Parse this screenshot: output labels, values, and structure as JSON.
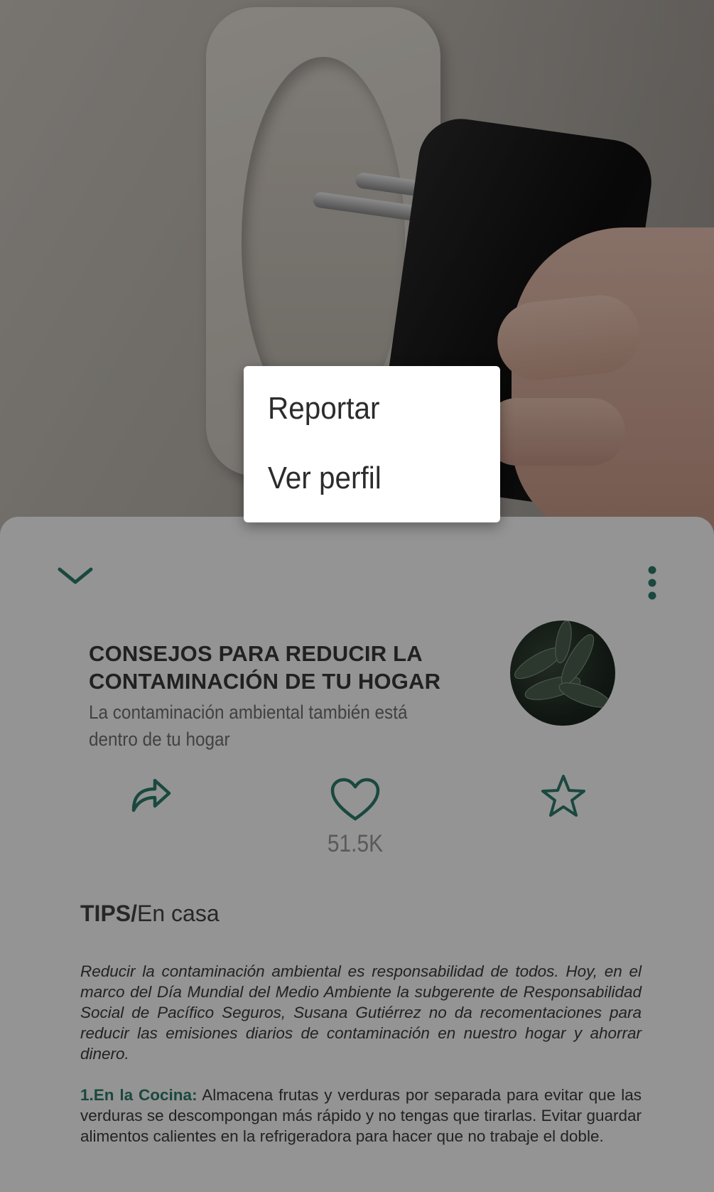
{
  "menu": {
    "items": [
      {
        "label": "Reportar"
      },
      {
        "label": "Ver perfil"
      }
    ]
  },
  "article": {
    "title": "CONSEJOS PARA REDUCIR LA CONTAMINACIÓN DE TU HOGAR",
    "subtitle": "La contaminación ambiental también está dentro de tu hogar",
    "likes": "51.5K",
    "category": {
      "main": "TIPS/",
      "sub": "En casa"
    },
    "intro": "Reducir la contaminación ambiental es responsabilidad de todos. Hoy, en el marco del Día Mundial del Medio Ambiente la subgerente de Responsabilidad Social de Pacífico Seguros, Susana Gutiérrez no da recomentaciones para reducir las emisiones diarios de contaminación en nuestro hogar y ahorrar dinero.",
    "tip1_label": "1.En la Cocina:",
    "tip1_text": " Almacena frutas y verduras por separada para evitar que las verduras se descompongan más rápido y no tengas que tirarlas. Evitar guardar alimentos calientes en la refrigeradora para hacer que no trabaje el doble."
  },
  "colors": {
    "accent": "#2e7d6c",
    "text": "#3c3c3c"
  },
  "icons": {
    "collapse": "chevron-down-icon",
    "more": "more-vertical-icon",
    "share": "share-icon",
    "like": "heart-icon",
    "favorite": "star-icon"
  }
}
